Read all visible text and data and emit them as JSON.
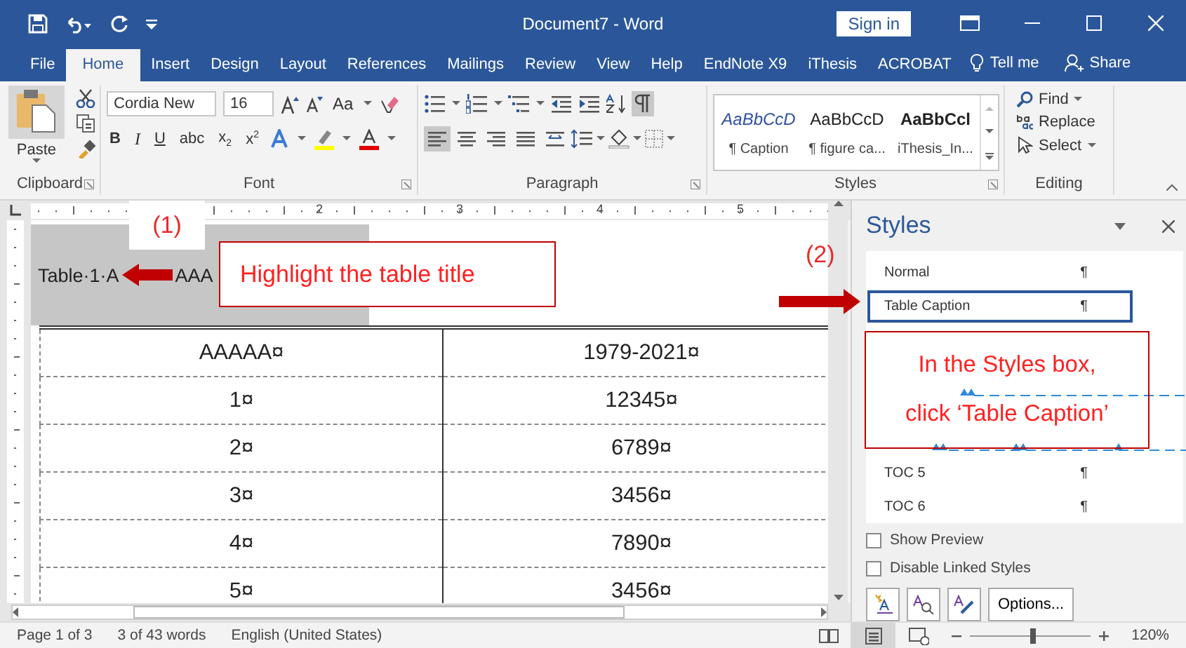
{
  "title_bar": {
    "title": "Document7  -  Word",
    "sign_in": "Sign in"
  },
  "tabs": [
    {
      "label": "File",
      "selected": false
    },
    {
      "label": "Home",
      "selected": true
    },
    {
      "label": "Insert",
      "selected": false
    },
    {
      "label": "Design",
      "selected": false
    },
    {
      "label": "Layout",
      "selected": false
    },
    {
      "label": "References",
      "selected": false
    },
    {
      "label": "Mailings",
      "selected": false
    },
    {
      "label": "Review",
      "selected": false
    },
    {
      "label": "View",
      "selected": false
    },
    {
      "label": "Help",
      "selected": false
    },
    {
      "label": "EndNote X9",
      "selected": false
    },
    {
      "label": "iThesis",
      "selected": false
    },
    {
      "label": "ACROBAT",
      "selected": false
    }
  ],
  "tell_me": "Tell me",
  "share": "Share",
  "ribbon": {
    "clipboard": {
      "paste": "Paste",
      "label": "Clipboard"
    },
    "font": {
      "name": "Cordia New",
      "size": "16",
      "case_button": "Aa",
      "buttons": [
        "B",
        "I",
        "U",
        "abc",
        "x$_{2}$",
        "x$^{2}$"
      ],
      "label": "Font"
    },
    "paragraph": {
      "label": "Paragraph",
      "show_marks": {
        "selected": true
      },
      "alignment": [
        {
          "kind": "left",
          "selected": true
        },
        {
          "kind": "center",
          "selected": false
        },
        {
          "kind": "right",
          "selected": false
        },
        {
          "kind": "justify",
          "selected": false
        },
        {
          "kind": "distributed",
          "selected": false
        }
      ]
    },
    "styles": {
      "label": "Styles",
      "gallery": [
        {
          "sample": "AaBbCcD",
          "name": "¶ Caption",
          "kind": "italic"
        },
        {
          "sample": "AaBbCcD",
          "name": "¶ figure ca...",
          "kind": "plain"
        },
        {
          "sample": "AaBbCcl",
          "name": "iThesis_In...",
          "kind": "bold"
        }
      ]
    },
    "editing": {
      "label": "Editing",
      "find": "Find",
      "replace": "Replace",
      "select": "Select"
    }
  },
  "ruler": {
    "numbers": [
      "2",
      "3",
      "4",
      "5"
    ]
  },
  "document": {
    "title_parts": [
      "Table·1·A",
      "AAA"
    ],
    "table": {
      "rows": [
        [
          "AAAAA¤",
          "1979-2021¤"
        ],
        [
          "1¤",
          "12345¤"
        ],
        [
          "2¤",
          "6789¤"
        ],
        [
          "3¤",
          "3456¤"
        ],
        [
          "4¤",
          "7890¤"
        ],
        [
          "5¤",
          "3456¤"
        ]
      ]
    }
  },
  "annotations": {
    "step1": "(1)",
    "step1_callout": "Highlight the table title",
    "step2": "(2)",
    "step2_callout_lines": [
      "In the Styles box,",
      "click ‘Table Caption’"
    ]
  },
  "styles_pane": {
    "title": "Styles",
    "items_above": [
      {
        "name": "Normal",
        "mark": "¶",
        "selected": false
      },
      {
        "name": "Table Caption",
        "mark": "¶",
        "selected": true
      }
    ],
    "items_below": [
      {
        "name": "TOC 5",
        "mark": "¶",
        "selected": false
      },
      {
        "name": "TOC 6",
        "mark": "¶",
        "selected": false
      }
    ],
    "options": [
      {
        "label": "Show Preview",
        "checked": false
      },
      {
        "label": "Disable Linked Styles",
        "checked": false
      }
    ],
    "options_button": "Options..."
  },
  "status_bar": {
    "page": "Page 1 of 3",
    "words": "3 of 43 words",
    "language": "English (United States)",
    "views": [
      {
        "kind": "read",
        "selected": false
      },
      {
        "kind": "print",
        "selected": true
      },
      {
        "kind": "web",
        "selected": false
      }
    ],
    "zoom": {
      "level": 0.52,
      "reading": "120%"
    }
  }
}
